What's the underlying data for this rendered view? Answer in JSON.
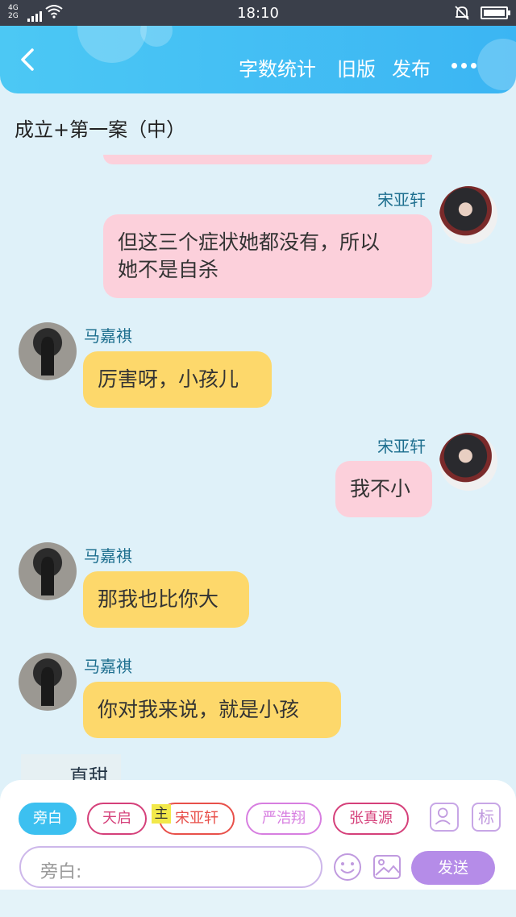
{
  "status_bar": {
    "network_top": "4G",
    "network_bottom": "2G",
    "time": "18:10",
    "icons": [
      "signal-icon",
      "wifi-icon",
      "bell-muted-icon",
      "battery-icon"
    ]
  },
  "header": {
    "back_icon": "chevron-left-icon",
    "actions": [
      "字数统计",
      "旧版",
      "发布"
    ],
    "more_icon": "more-dots-icon",
    "accent_color": "#3bb5f3"
  },
  "chapter": {
    "title": "成立+第一案（中）"
  },
  "messages": [
    {
      "sender": "宋亚轩",
      "text_lines": [
        "但这三个症状她都没有，所以",
        "她不是自杀"
      ],
      "side": "right",
      "color": "#fcd0db"
    },
    {
      "sender": "马嘉祺",
      "text_lines": [
        "厉害呀，小孩儿"
      ],
      "side": "left",
      "color": "#fdd86b"
    },
    {
      "sender": "宋亚轩",
      "text_lines": [
        "我不小"
      ],
      "side": "right",
      "color": "#fcd0db"
    },
    {
      "sender": "马嘉祺",
      "text_lines": [
        "那我也比你大"
      ],
      "side": "left",
      "color": "#fdd86b"
    },
    {
      "sender": "马嘉祺",
      "text_lines": [
        "你对我来说，就是小孩"
      ],
      "side": "left",
      "color": "#fdd86b"
    }
  ],
  "partial_message": "直甜",
  "composer": {
    "roles": [
      {
        "label": "旁白",
        "selected": true,
        "color": "#3cc0f0"
      },
      {
        "label": "天启",
        "selected": false,
        "color": "#d5407a"
      },
      {
        "label": "宋亚轩",
        "selected": false,
        "color": "#e8504a"
      },
      {
        "label": "严浩翔",
        "selected": false,
        "color": "#d77ee0"
      },
      {
        "label": "张真源",
        "selected": false,
        "color": "#d5407a"
      }
    ],
    "main_tag": "主",
    "tool_icons": [
      "person-card-icon",
      "tag-icon"
    ],
    "tag_icon_text": "标",
    "input_placeholder": "旁白:",
    "emoji_icon": "emoji-icon",
    "image_icon": "image-icon",
    "send_label": "发送",
    "send_color": "#b58ce8"
  }
}
